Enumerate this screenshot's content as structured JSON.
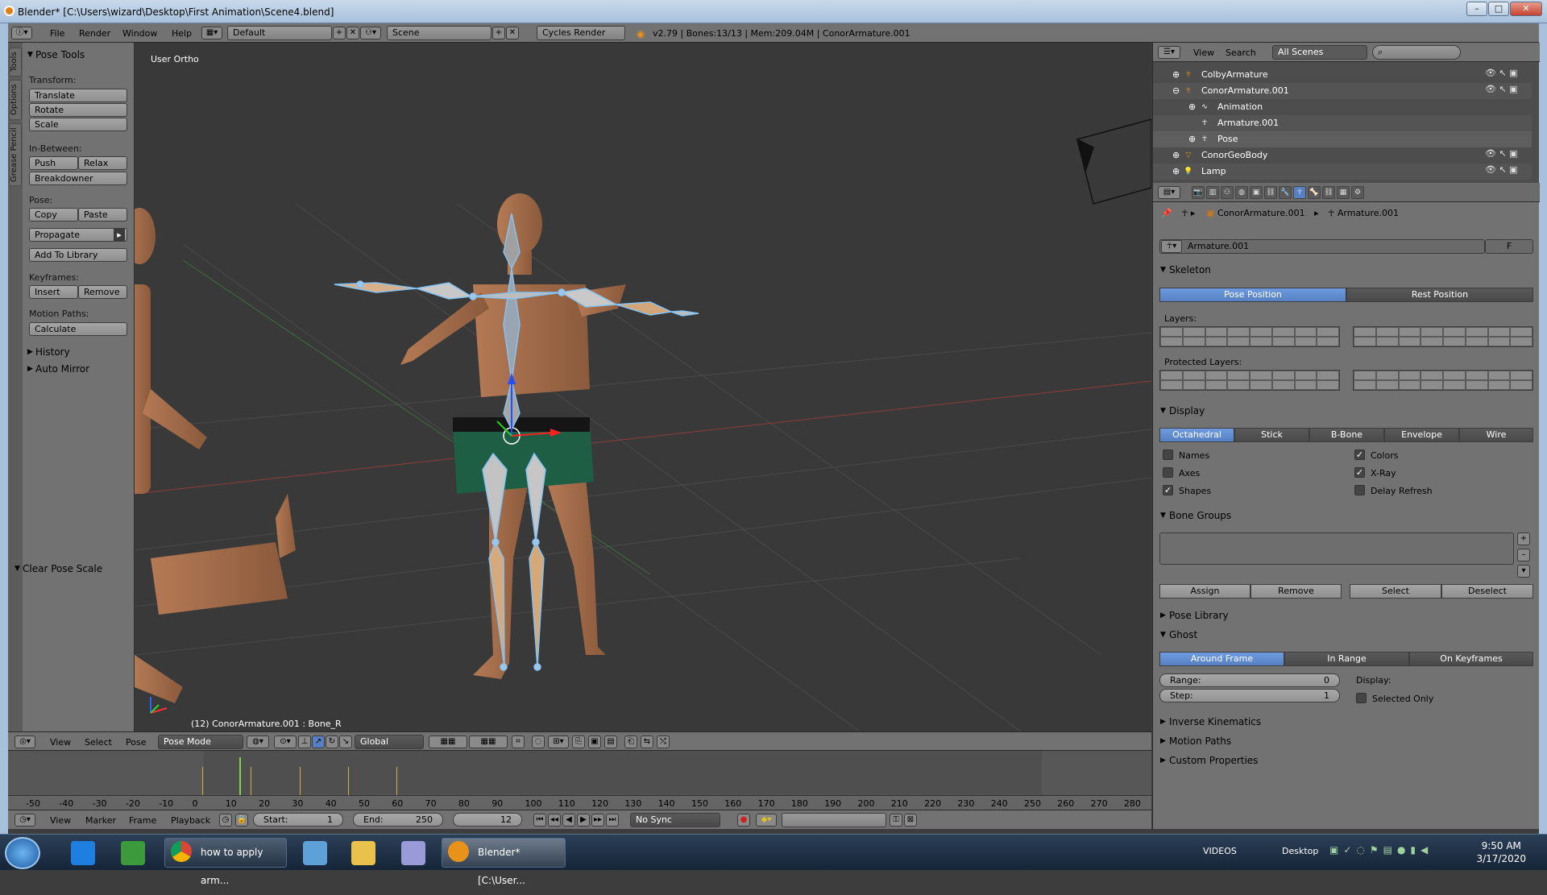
{
  "window": {
    "title": "Blender* [C:\\Users\\wizard\\Desktop\\First Animation\\Scene4.blend]",
    "min": "–",
    "max": "□",
    "close": "✕"
  },
  "top_header": {
    "menus": [
      "File",
      "Render",
      "Window",
      "Help"
    ],
    "layout": "Default",
    "scene": "Scene",
    "engine": "Cycles Render",
    "stats": "v2.79 | Bones:13/13 | Mem:209.04M | ConorArmature.001"
  },
  "tool_shelf": {
    "tabs": [
      "Tools",
      "Options",
      "Grease Pencil"
    ],
    "pose_tools": "Pose Tools",
    "transform_label": "Transform:",
    "translate": "Translate",
    "rotate": "Rotate",
    "scale": "Scale",
    "inbetween_label": "In-Between:",
    "push": "Push",
    "relax": "Relax",
    "breakdowner": "Breakdowner",
    "pose_label": "Pose:",
    "copy": "Copy",
    "paste": "Paste",
    "propagate": "Propagate",
    "add_to_library": "Add To Library",
    "keyframes_label": "Keyframes:",
    "insert": "Insert",
    "remove": "Remove",
    "motion_paths_label": "Motion Paths:",
    "calculate": "Calculate",
    "history": "History",
    "auto_mirror": "Auto Mirror",
    "clear_pose_scale": "Clear Pose Scale"
  },
  "viewport": {
    "label": "User Ortho",
    "status": "(12) ConorArmature.001 : Bone_R"
  },
  "viewport_header": {
    "menus": [
      "View",
      "Select",
      "Pose"
    ],
    "mode": "Pose Mode",
    "orientation": "Global"
  },
  "timeline": {
    "ticks": [
      "-50",
      "-40",
      "-30",
      "-20",
      "-10",
      "0",
      "10",
      "20",
      "30",
      "40",
      "50",
      "60",
      "70",
      "80",
      "90",
      "100",
      "110",
      "120",
      "130",
      "140",
      "150",
      "160",
      "170",
      "180",
      "190",
      "200",
      "210",
      "220",
      "230",
      "240",
      "250",
      "260",
      "270",
      "280"
    ],
    "current_frame": 12,
    "menus": [
      "View",
      "Marker",
      "Frame",
      "Playback"
    ],
    "start_label": "Start:",
    "start": "1",
    "end_label": "End:",
    "end": "250",
    "frame": "12",
    "sync": "No Sync"
  },
  "outliner": {
    "view": "View",
    "search": "Search",
    "filter": "All Scenes",
    "rows": [
      {
        "name": "ColbyArmature"
      },
      {
        "name": "ConorArmature.001"
      },
      {
        "name": "Animation"
      },
      {
        "name": "Armature.001"
      },
      {
        "name": "Pose"
      },
      {
        "name": "ConorGeoBody"
      },
      {
        "name": "Lamp"
      }
    ]
  },
  "properties": {
    "breadcrumb_object": "ConorArmature.001",
    "breadcrumb_data": "Armature.001",
    "datablock": "Armature.001",
    "fake_user": "F",
    "skeleton": "Skeleton",
    "pose_position": "Pose Position",
    "rest_position": "Rest Position",
    "layers_label": "Layers:",
    "protected_layers_label": "Protected Layers:",
    "display": "Display",
    "display_types": [
      "Octahedral",
      "Stick",
      "B-Bone",
      "Envelope",
      "Wire"
    ],
    "names": "Names",
    "axes": "Axes",
    "shapes": "Shapes",
    "colors": "Colors",
    "xray": "X-Ray",
    "delay_refresh": "Delay Refresh",
    "bone_groups": "Bone Groups",
    "assign": "Assign",
    "remove": "Remove",
    "select": "Select",
    "deselect": "Deselect",
    "pose_library": "Pose Library",
    "ghost": "Ghost",
    "ghost_types": [
      "Around Frame",
      "In Range",
      "On Keyframes"
    ],
    "range_label": "Range:",
    "range": "0",
    "step_label": "Step:",
    "step": "1",
    "display_label": "Display:",
    "selected_only": "Selected Only",
    "inverse_kinematics": "Inverse Kinematics",
    "motion_paths": "Motion Paths",
    "custom_properties": "Custom Properties"
  },
  "taskbar": {
    "chrome_task": "how to apply arm...",
    "blender_task": "Blender* [C:\\User...",
    "videos": "VIDEOS",
    "desktop": "Desktop",
    "time": "9:50 AM",
    "date": "3/17/2020"
  }
}
